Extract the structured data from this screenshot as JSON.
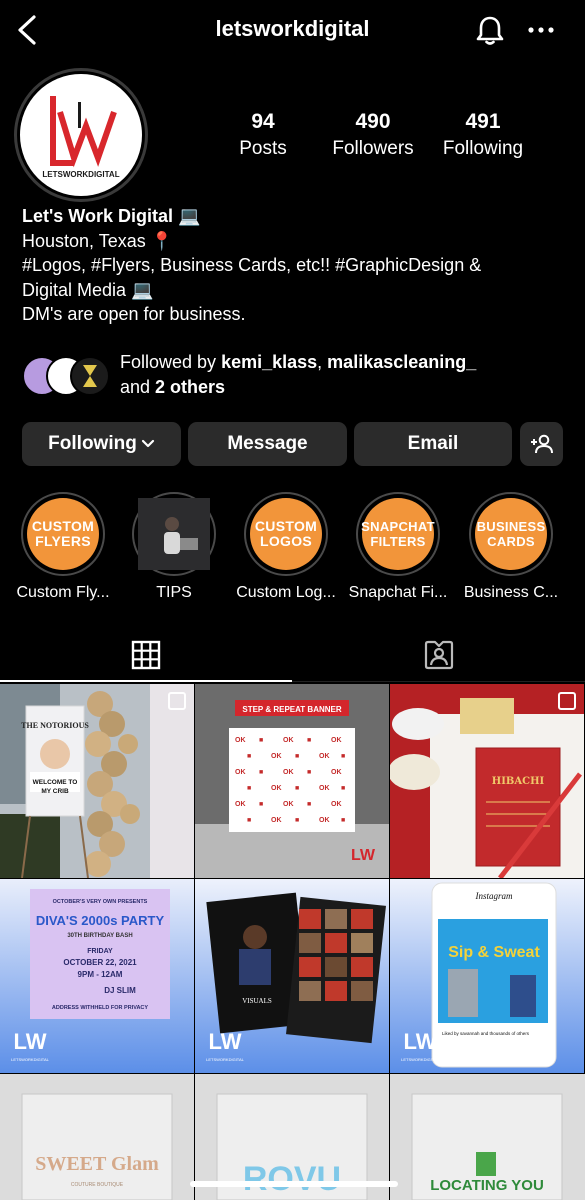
{
  "header": {
    "username": "letsworkdigital",
    "back_icon": "chevron-left-icon",
    "bell_icon": "bell-icon",
    "more_icon": "more-horizontal-icon"
  },
  "profile": {
    "avatar_logo": "LW",
    "avatar_caption": "LETSWORKDIGITAL",
    "stats": [
      {
        "num": "94",
        "label": "Posts"
      },
      {
        "num": "490",
        "label": "Followers"
      },
      {
        "num": "491",
        "label": "Following"
      }
    ],
    "name": "Let's Work Digital 💻",
    "bio_lines": [
      "Houston, Texas 📍",
      "#Logos, #Flyers, Business Cards, etc!! #GraphicDesign &",
      "Digital Media 💻",
      "DM's are open for business."
    ]
  },
  "followed_by": {
    "prefix": "Followed by ",
    "user1": "kemi_klass",
    "sep": ", ",
    "user2": "malikascleaning_",
    "line2_prefix": "and ",
    "others": "2 others"
  },
  "buttons": {
    "following": "Following",
    "message": "Message",
    "email": "Email"
  },
  "highlights": [
    {
      "line1": "CUSTOM",
      "line2": "FLYERS",
      "label": "Custom Fly..."
    },
    {
      "line1": "",
      "line2": "",
      "label": "TIPS"
    },
    {
      "line1": "CUSTOM",
      "line2": "LOGOS",
      "label": "Custom Log..."
    },
    {
      "line1": "SNAPCHAT",
      "line2": "FILTERS",
      "label": "Snapchat Fi..."
    },
    {
      "line1": "BUSINESS",
      "line2": "CARDS",
      "label": "Business C..."
    }
  ],
  "posts": {
    "p1_text": "THE NOTORIOUS",
    "p1_sub": "WELCOME TO MY CRIB",
    "p2_banner": "STEP & REPEAT BANNER",
    "p3_title": "HIBACHI",
    "p4_pre": "OCTOBER'S VERY OWN PRESENTS",
    "p4_title": "DIVA'S 2000s PARTY",
    "p4_sub": "30TH BIRTHDAY BASH",
    "p4_day": "FRIDAY",
    "p4_date": "OCTOBER 22, 2021",
    "p4_time": "9PM - 12AM",
    "p4_dj": "DJ SLIM",
    "p4_addr": "ADDRESS WITHHELD FOR PRIVACY",
    "p5_brand": "VISUALS",
    "p6_app": "Instagram",
    "p6_title": "Sip & Sweat",
    "p6_caption": "Liked by savannah and thousands of others",
    "p7_text": "SWEET Glam",
    "p7_sub": "COUTURE BOUTIQUE",
    "p8_text": "ROVU",
    "p9_text": "LOCATING YOU",
    "watermark": "LW",
    "watermark_sub": "LETSWORKDIGITAL"
  }
}
